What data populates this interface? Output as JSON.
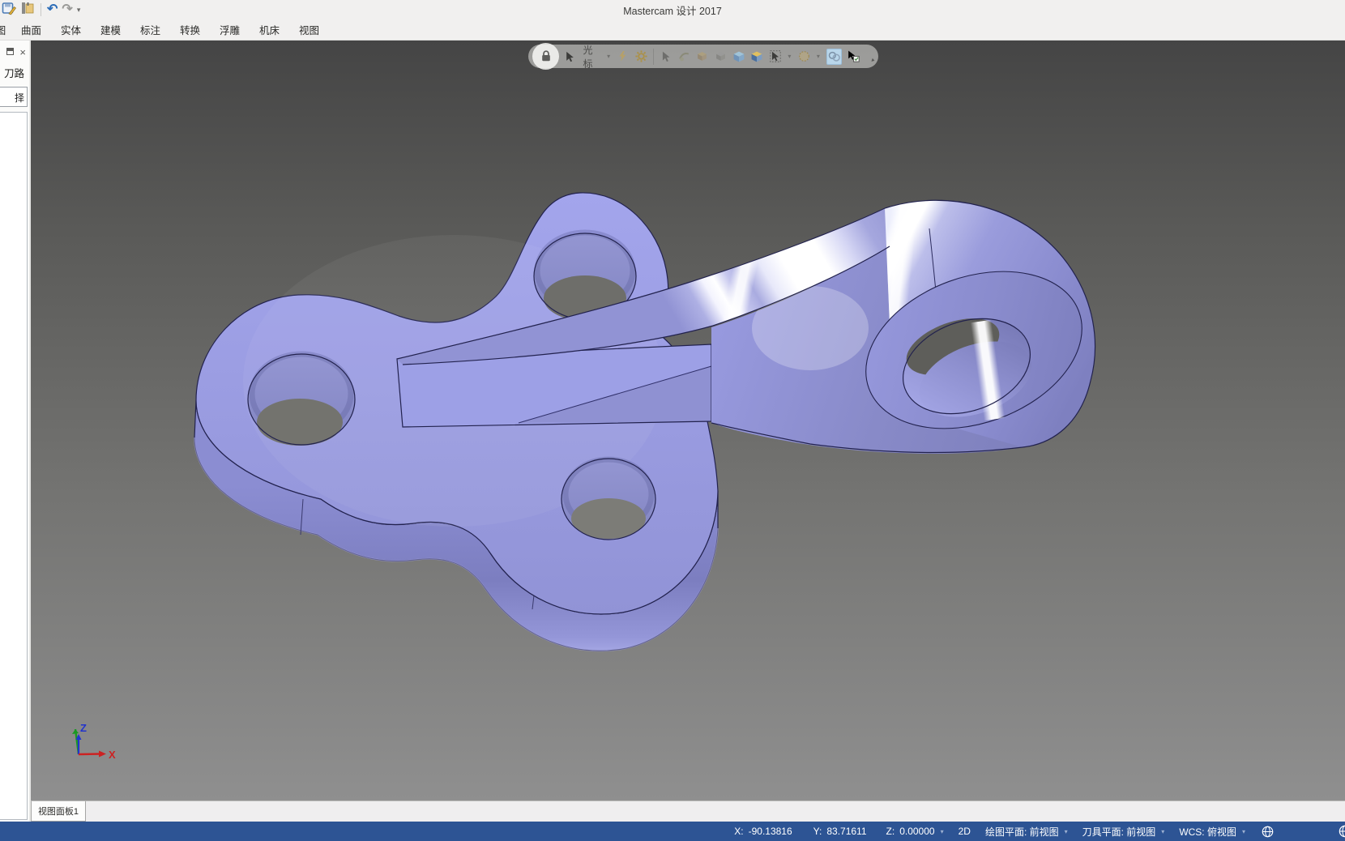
{
  "window": {
    "title": "Mastercam 设计 2017"
  },
  "quick_access": {
    "undo_glyph": "↶",
    "redo_glyph": "↷",
    "more_glyph": "▾"
  },
  "menu": {
    "tabs": [
      "图",
      "曲面",
      "实体",
      "建模",
      "标注",
      "转换",
      "浮雕",
      "机床",
      "视图"
    ]
  },
  "left_panel": {
    "tab_label": "刀路",
    "close_glyph": "×",
    "input_text": "择"
  },
  "float_toolbar": {
    "cursor_label": "光标",
    "caret_glyph": "▾",
    "icons": [
      "lock-icon",
      "cursor-select-icon",
      "lightning-icon",
      "gear-icon",
      "pick-arrow-icon",
      "pick-entity-icon",
      "pick-face-icon",
      "pick-body-icon",
      "solid-cube-icon",
      "multi-cube-icon",
      "cursor-target-icon",
      "grid-pattern-icon",
      "analyze-toggle-icon",
      "cursor-check-icon",
      "rotate-icon"
    ]
  },
  "viewport": {
    "bottom_tab_label": "视图面板1"
  },
  "gnomon": {
    "x_label": "X",
    "z_label": "Z"
  },
  "status_bar": {
    "x_label": "X:",
    "x_value": "-90.13816",
    "y_label": "Y:",
    "y_value": "83.71611",
    "z_label": "Z:",
    "z_value": "0.00000",
    "mode": "2D",
    "cplane": "绘图平面: 前视图",
    "tplane": "刀具平面: 前视图",
    "wcs": "WCS: 俯视图",
    "caret_glyph": "▾"
  },
  "colors": {
    "part_face": "#9b9de2",
    "part_side": "#8486c8",
    "edge_line": "#22224e",
    "highlight": "#ffffff",
    "viewport_top": "#454545",
    "viewport_bottom": "#8f8f8f",
    "statusbar_bg": "#2d5494",
    "axis_x": "#cc2222",
    "axis_y": "#1a9922",
    "axis_z": "#2233cc"
  }
}
